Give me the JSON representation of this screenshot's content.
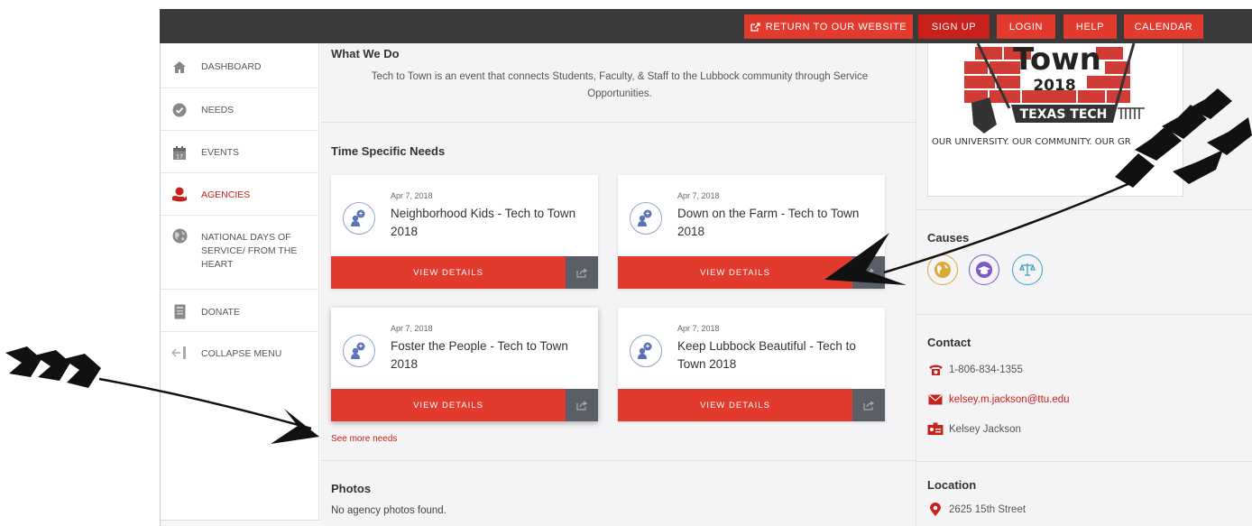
{
  "topbar": {
    "buttons": [
      {
        "label": "Return to our website"
      },
      {
        "label": "Sign up"
      },
      {
        "label": "Login"
      },
      {
        "label": "Help"
      },
      {
        "label": "Calendar"
      }
    ]
  },
  "sidebar": {
    "items": [
      {
        "label": "DASHBOARD",
        "icon": "home-icon"
      },
      {
        "label": "NEEDS",
        "icon": "check-circle-icon"
      },
      {
        "label": "EVENTS",
        "icon": "calendar-icon"
      },
      {
        "label": "AGENCIES",
        "icon": "agency-hand-icon"
      },
      {
        "label": "NATIONAL DAYS OF SERVICE/ FROM THE HEART",
        "icon": "globe-icon"
      },
      {
        "label": "DONATE",
        "icon": "donate-icon"
      },
      {
        "label": "COLLAPSE MENU",
        "icon": "collapse-arrow-icon"
      }
    ]
  },
  "main": {
    "what_we_do_title": "What We Do",
    "what_we_do_desc": "Tech to Town is an event that connects Students, Faculty, & Staff to the Lubbock community through Service Opportunities.",
    "needs_title": "Time Specific Needs",
    "cards": [
      {
        "date": "Apr 7, 2018",
        "title": "Neighborhood Kids - Tech to Town 2018",
        "button": "VIEW DETAILS"
      },
      {
        "date": "Apr 7, 2018",
        "title": "Down on the Farm - Tech to Town 2018",
        "button": "VIEW DETAILS"
      },
      {
        "date": "Apr 7, 2018",
        "title": "Foster the People - Tech to Town 2018",
        "button": "VIEW DETAILS"
      },
      {
        "date": "Apr 7, 2018",
        "title": "Keep Lubbock Beautiful - Tech to Town 2018",
        "button": "VIEW DETAILS"
      }
    ],
    "see_more": "See more needs",
    "photos_title": "Photos",
    "photos_empty": "No agency photos found."
  },
  "right": {
    "logo": {
      "word": "Town",
      "year": "2018",
      "banner": "TEXAS TECH",
      "tagline": "OUR UNIVERSITY. OUR COMMUNITY. OUR GR"
    },
    "causes_title": "Causes",
    "contact_title": "Contact",
    "phone": "1-806-834-1355",
    "email": "kelsey.m.jackson@ttu.edu",
    "contact_name": "Kelsey Jackson",
    "location_title": "Location",
    "address": "2625 15th Street"
  },
  "colors": {
    "brand_red": "#e23b2e",
    "topbar": "#3a3a3a",
    "share_gray": "#5a5e66"
  }
}
